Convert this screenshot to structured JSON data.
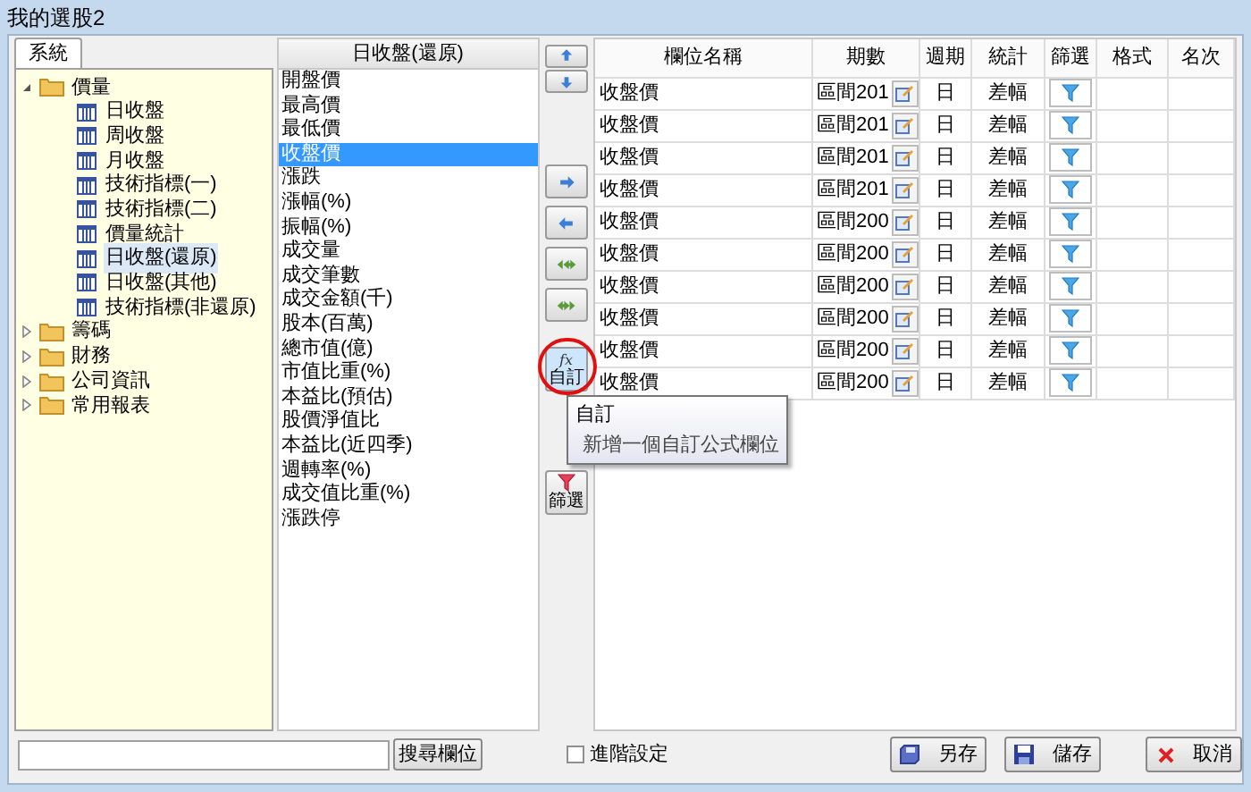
{
  "window": {
    "title": "我的選股2"
  },
  "left_tab": {
    "label": "系統",
    "selected": true
  },
  "tree": [
    {
      "label": "價量",
      "expanded": true,
      "children": [
        {
          "label": "日收盤",
          "selected": false
        },
        {
          "label": "周收盤",
          "selected": false
        },
        {
          "label": "月收盤",
          "selected": false
        },
        {
          "label": "技術指標(一)",
          "selected": false
        },
        {
          "label": "技術指標(二)",
          "selected": false
        },
        {
          "label": "價量統計",
          "selected": false
        },
        {
          "label": "日收盤(還原)",
          "selected": true
        },
        {
          "label": "日收盤(其他)",
          "selected": false
        },
        {
          "label": "技術指標(非還原)",
          "selected": false
        }
      ]
    },
    {
      "label": "籌碼",
      "expanded": false
    },
    {
      "label": "財務",
      "expanded": false
    },
    {
      "label": "公司資訊",
      "expanded": false
    },
    {
      "label": "常用報表",
      "expanded": false
    }
  ],
  "field_list": {
    "header": "日收盤(還原)",
    "items": [
      {
        "label": "開盤價",
        "selected": false
      },
      {
        "label": "最高價",
        "selected": false
      },
      {
        "label": "最低價",
        "selected": false
      },
      {
        "label": "收盤價",
        "selected": true
      },
      {
        "label": "漲跌",
        "selected": false
      },
      {
        "label": "漲幅(%)",
        "selected": false
      },
      {
        "label": "振幅(%)",
        "selected": false
      },
      {
        "label": "成交量",
        "selected": false
      },
      {
        "label": "成交筆數",
        "selected": false
      },
      {
        "label": "成交金額(千)",
        "selected": false
      },
      {
        "label": "股本(百萬)",
        "selected": false
      },
      {
        "label": "總市值(億)",
        "selected": false
      },
      {
        "label": "市值比重(%)",
        "selected": false
      },
      {
        "label": "本益比(預估)",
        "selected": false
      },
      {
        "label": "股價淨值比",
        "selected": false
      },
      {
        "label": "本益比(近四季)",
        "selected": false
      },
      {
        "label": "週轉率(%)",
        "selected": false
      },
      {
        "label": "成交值比重(%)",
        "selected": false
      },
      {
        "label": "漲跌停",
        "selected": false
      }
    ]
  },
  "side_buttons": [
    {
      "kind": "up"
    },
    {
      "kind": "down"
    },
    {
      "kind": "right"
    },
    {
      "kind": "left"
    },
    {
      "kind": "left-all"
    },
    {
      "kind": "right-all"
    },
    {
      "kind": "custom",
      "icon_text": "fx",
      "label": "自訂",
      "highlighted": true
    },
    {
      "kind": "filter",
      "label": "篩選"
    }
  ],
  "tooltip": {
    "title": "自訂",
    "text": "新增一個自訂公式欄位"
  },
  "table": {
    "columns": [
      "欄位名稱",
      "期數",
      "週期",
      "統計",
      "篩選",
      "格式",
      "名次"
    ],
    "rows": [
      {
        "name": "收盤價",
        "period": "區間201",
        "cycle": "日",
        "stat": "差幅"
      },
      {
        "name": "收盤價",
        "period": "區間201",
        "cycle": "日",
        "stat": "差幅"
      },
      {
        "name": "收盤價",
        "period": "區間201",
        "cycle": "日",
        "stat": "差幅"
      },
      {
        "name": "收盤價",
        "period": "區間201",
        "cycle": "日",
        "stat": "差幅"
      },
      {
        "name": "收盤價",
        "period": "區間200",
        "cycle": "日",
        "stat": "差幅"
      },
      {
        "name": "收盤價",
        "period": "區間200",
        "cycle": "日",
        "stat": "差幅"
      },
      {
        "name": "收盤價",
        "period": "區間200",
        "cycle": "日",
        "stat": "差幅"
      },
      {
        "name": "收盤價",
        "period": "區間200",
        "cycle": "日",
        "stat": "差幅"
      },
      {
        "name": "收盤價",
        "period": "區間200",
        "cycle": "日",
        "stat": "差幅"
      },
      {
        "name": "收盤價",
        "period": "區間200",
        "cycle": "日",
        "stat": "差幅"
      }
    ]
  },
  "search": {
    "button": "搜尋欄位"
  },
  "advanced": {
    "label": "進階設定",
    "checked": false
  },
  "buttons": [
    {
      "kind": "save-as",
      "label": "另存"
    },
    {
      "kind": "save",
      "label": "儲存"
    },
    {
      "kind": "cancel",
      "label": "取消"
    }
  ]
}
